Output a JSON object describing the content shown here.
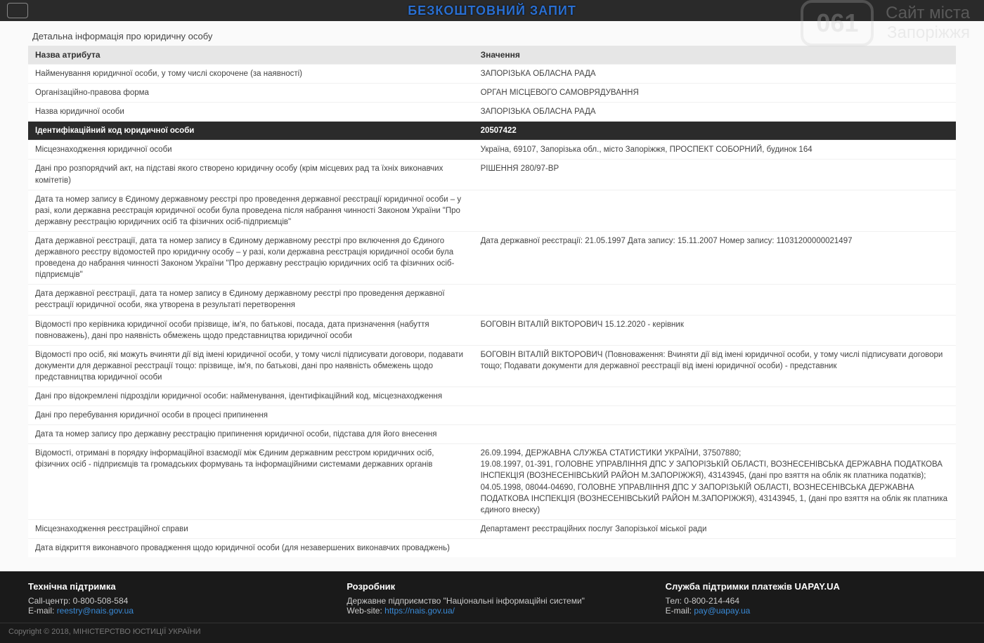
{
  "header": {
    "title": "БЕЗКОШТОВНИЙ ЗАПИТ"
  },
  "watermark": {
    "badge": "061",
    "line1": "Сайт міста",
    "line2": "Запоріжжя"
  },
  "section_title": "Детальна інформація про юридичну особу",
  "table": {
    "headers": {
      "attr": "Назва атрибута",
      "val": "Значення"
    },
    "rows": [
      {
        "attr": "Найменування юридичної особи, у тому числі скорочене (за наявності)",
        "val": "ЗАПОРІЗЬКА ОБЛАСНА РАДА"
      },
      {
        "attr": "Організаційно-правова форма",
        "val": "ОРГАН МІСЦЕВОГО САМОВРЯДУВАННЯ"
      },
      {
        "attr": "Назва юридичної особи",
        "val": "ЗАПОРІЗЬКА ОБЛАСНА РАДА"
      },
      {
        "attr": "Ідентифікаційний код юридичної особи",
        "val": "20507422",
        "hl": true
      },
      {
        "attr": "Місцезнаходження юридичної особи",
        "val": "Україна, 69107, Запорізька обл., місто Запоріжжя, ПРОСПЕКТ СОБОРНИЙ, будинок 164"
      },
      {
        "attr": "Дані про розпорядчий акт, на підставі якого створено юридичну особу (крім місцевих рад та їхніх виконавчих комітетів)",
        "val": "РІШЕННЯ 280/97-ВР"
      },
      {
        "attr": "Дата та номер запису в Єдиному державному реєстрі про проведення державної реєстрації юридичної особи – у разі, коли державна реєстрація юридичної особи була проведена після набрання чинності Законом України \"Про державну реєстрацію юридичних осіб та фізичних осіб-підприємців\"",
        "val": ""
      },
      {
        "attr": "Дата державної реєстрації, дата та номер запису в Єдиному державному реєстрі про включення до Єдиного державного реєстру відомостей про юридичну особу – у разі, коли державна реєстрація юридичної особи була проведена до набрання чинності Законом України \"Про державну реєстрацію юридичних осіб та фізичних осіб-підприємців\"",
        "val": "Дата державної реєстрації: 21.05.1997 Дата запису: 15.11.2007 Номер запису: 11031200000021497"
      },
      {
        "attr": "Дата державної реєстрації, дата та номер запису в Єдиному державному реєстрі про проведення державної реєстрації юридичної особи, яка утворена в результаті перетворення",
        "val": ""
      },
      {
        "attr": "Відомості про керівника юридичної особи прізвище, ім'я, по батькові, посада, дата призначення (набуття повноважень), дані про наявність обмежень щодо представництва юридичної особи",
        "val": "БОГОВІН ВІТАЛІЙ ВІКТОРОВИЧ 15.12.2020 - керівник"
      },
      {
        "attr": "Відомості про осіб, які можуть вчиняти дії від імені юридичної особи, у тому числі підписувати договори, подавати документи для державної реєстрації тощо: прізвище, ім'я, по батькові, дані про наявність обмежень щодо представництва юридичної особи",
        "val": "БОГОВІН ВІТАЛІЙ ВІКТОРОВИЧ (Повноваження: Вчиняти дії від імені юридичної особи, у тому числі підписувати договори тощо; Подавати документи для державної реєстрації від імені юридичної особи) - представник"
      },
      {
        "attr": "Дані про відокремлені підрозділи юридичної особи: найменування, ідентифікаційний код, місцезнаходження",
        "val": ""
      },
      {
        "attr": "Дані про перебування юридичної особи в процесі припинення",
        "val": ""
      },
      {
        "attr": "Дата та номер запису про державну реєстрацію припинення юридичної особи, підстава для його внесення",
        "val": ""
      },
      {
        "attr": "Відомості, отримані в порядку інформаційної взаємодії між Єдиним державним реєстром юридичних осіб, фізичних осіб - підприємців та громадських формувань та інформаційними системами державних органів",
        "val": "26.09.1994, ДЕРЖАВНА СЛУЖБА СТАТИСТИКИ УКРАЇНИ, 37507880;\n19.08.1997, 01-391, ГОЛОВНЕ УПРАВЛІННЯ ДПС У ЗАПОРІЗЬКІЙ ОБЛАСТІ, ВОЗНЕСЕНІВСЬКА ДЕРЖАВНА ПОДАТКОВА ІНСПЕКЦІЯ (ВОЗНЕСЕНІВСЬКИЙ РАЙОН М.ЗАПОРІЖЖЯ), 43143945, (дані про взяття на облік як платника податків);\n04.05.1998, 08044-04690, ГОЛОВНЕ УПРАВЛІННЯ ДПС У ЗАПОРІЗЬКІЙ ОБЛАСТІ, ВОЗНЕСЕНІВСЬКА ДЕРЖАВНА ПОДАТКОВА ІНСПЕКЦІЯ (ВОЗНЕСЕНІВСЬКИЙ РАЙОН М.ЗАПОРІЖЖЯ), 43143945, 1, (дані про взяття на облік як платника єдиного внеску)"
      },
      {
        "attr": "Місцезнаходження реєстраційної справи",
        "val": "Департамент реєстраційних послуг Запорізької міської ради"
      },
      {
        "attr": "Дата відкриття виконавчого провадження щодо юридичної особи (для незавершених виконавчих проваджень)",
        "val": ""
      }
    ]
  },
  "footer": {
    "support": {
      "title": "Технічна підтримка",
      "call_label": "Call-центр:",
      "call_value": "0-800-508-584",
      "email_label": "E-mail:",
      "email_link": "reestry@nais.gov.ua"
    },
    "developer": {
      "title": "Розробник",
      "org": "Державне підприємство \"Національні інформаційні системи\"",
      "site_label": "Web-site:",
      "site_link": "https://nais.gov.ua/"
    },
    "payment": {
      "title": "Служба підтримки платежів UAPAY.UA",
      "tel_label": "Тел:",
      "tel_value": "0-800-214-464",
      "email_label": "E-mail:",
      "email_link": "pay@uapay.ua"
    }
  },
  "copyright": "Copyright © 2018, МІНІСТЕРСТВО ЮСТИЦІЇ УКРАЇНИ"
}
